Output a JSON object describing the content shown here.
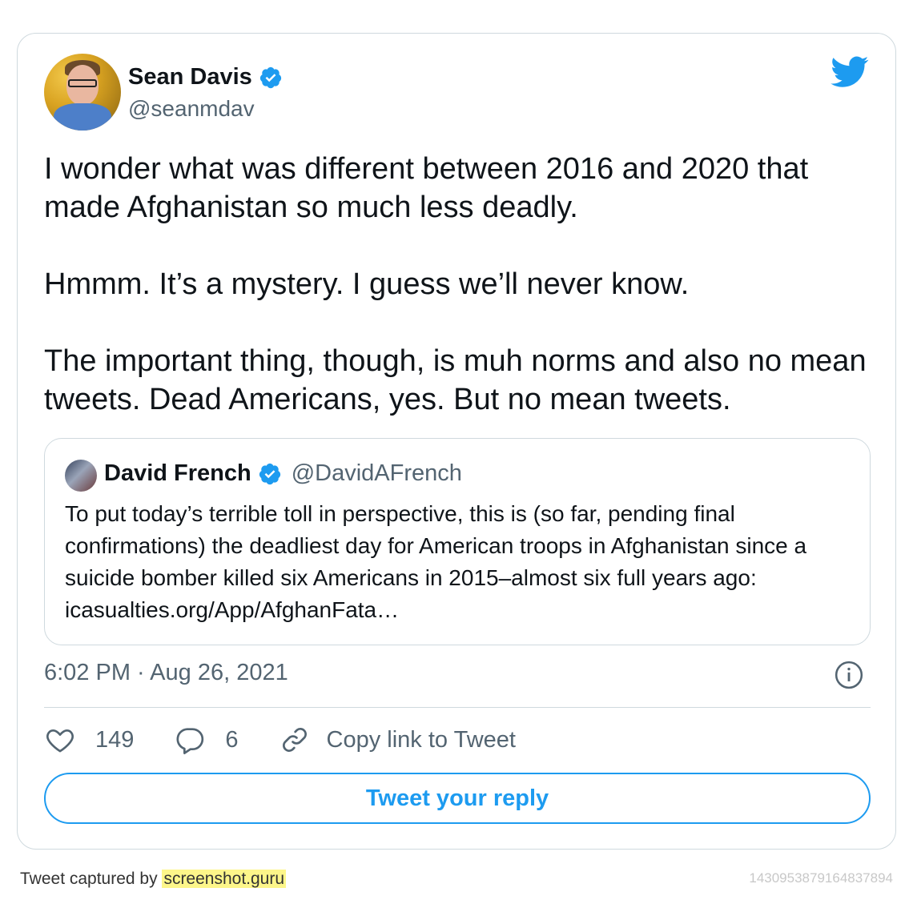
{
  "author": {
    "display_name": "Sean Davis",
    "handle": "@seanmdav",
    "verified_icon": "verified-badge-icon"
  },
  "brand": {
    "icon": "twitter-bird-icon",
    "color": "#1d9bf0"
  },
  "tweet": {
    "text": "I wonder what was different between 2016 and 2020 that made Afghanistan so much less deadly.\n\nHmmm. It’s a mystery. I guess we’ll never know.\n\nThe important thing, though, is muh norms and also no mean tweets. Dead Americans, yes. But no mean tweets.",
    "timestamp": "6:02 PM · Aug 26, 2021"
  },
  "quoted_tweet": {
    "display_name": "David French",
    "handle": "@DavidAFrench",
    "text": "To put today’s terrible toll in perspective, this is (so far, pending final confirmations) the deadliest day for American troops in Afghanistan since a suicide bomber killed six Americans in 2015–almost six full years ago: icasualties.org/App/AfghanFata…"
  },
  "actions": {
    "likes": "149",
    "replies": "6",
    "copy_link": "Copy link to Tweet"
  },
  "reply_button": "Tweet your reply",
  "footer": {
    "captured_by": "Tweet captured by ",
    "site": "screenshot.guru",
    "tweet_id": "1430953879164837894"
  },
  "colors": {
    "accent": "#1d9bf0",
    "secondary_text": "#536471",
    "border": "#cfd9de",
    "highlight": "#fdf68a"
  }
}
